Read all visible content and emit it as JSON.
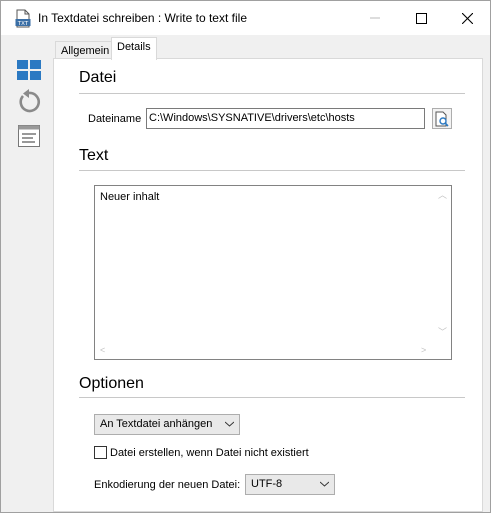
{
  "window": {
    "title": "In Textdatei schreiben : Write to text file",
    "app_icon_text": "TXT"
  },
  "colors": {
    "toolbar_blue": "#2b79c2",
    "toolbar_gray": "#808080"
  },
  "left_toolbar": {
    "icons": [
      "grid-view-icon",
      "refresh-icon",
      "text-view-icon"
    ]
  },
  "tabs": [
    {
      "label": "Allgemein",
      "active": false
    },
    {
      "label": "Details",
      "active": true
    }
  ],
  "sections": {
    "datei": {
      "title": "Datei",
      "filename_label": "Dateiname",
      "filename_value": "C:\\Windows\\SYSNATIVE\\drivers\\etc\\hosts"
    },
    "text": {
      "title": "Text",
      "content": "Neuer inhalt"
    },
    "optionen": {
      "title": "Optionen",
      "mode_selected": "An Textdatei anhängen",
      "create_checkbox_label": "Datei erstellen, wenn Datei nicht existiert",
      "create_checkbox_checked": false,
      "encoding_label": "Enkodierung der neuen Datei:",
      "encoding_selected": "UTF-8"
    }
  }
}
